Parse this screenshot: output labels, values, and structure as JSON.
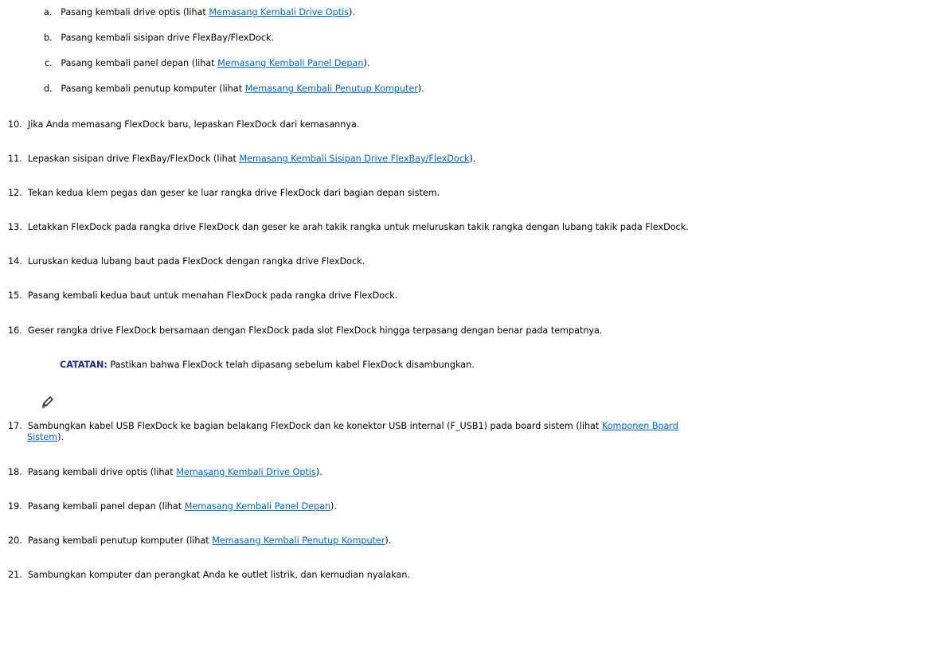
{
  "substeps": [
    {
      "marker": "a.",
      "pre": "Pasang kembali drive optis (lihat ",
      "link": "Memasang Kembali Drive Optis",
      "post": ")."
    },
    {
      "marker": "b.",
      "pre": "Pasang kembali sisipan drive FlexBay/FlexDock.",
      "link": "",
      "post": ""
    },
    {
      "marker": "c.",
      "pre": "Pasang kembali panel depan (lihat ",
      "link": "Memasang Kembali Panel Depan",
      "post": ")."
    },
    {
      "marker": "d.",
      "pre": "Pasang kembali penutup komputer (lihat ",
      "link": "Memasang Kembali Penutup Komputer",
      "post": ")."
    }
  ],
  "steps": [
    {
      "num": "10.",
      "pre": "Jika Anda memasang FlexDock baru, lepaskan FlexDock dari kemasannya.",
      "link": "",
      "post": ""
    },
    {
      "num": "11.",
      "pre": "Lepaskan sisipan drive FlexBay/FlexDock (lihat ",
      "link": "Memasang Kembali Sisipan Drive FlexBay/FlexDock",
      "post": ")."
    },
    {
      "num": "12.",
      "pre": "Tekan kedua klem pegas dan geser ke luar rangka drive FlexDock dari bagian depan sistem.",
      "link": "",
      "post": ""
    },
    {
      "num": "13.",
      "pre": "Letakkan FlexDock pada rangka drive FlexDock dan geser ke arah takik rangka untuk meluruskan takik rangka dengan lubang takik pada FlexDock.",
      "link": "",
      "post": ""
    },
    {
      "num": "14.",
      "pre": "Luruskan kedua lubang baut pada FlexDock dengan rangka drive FlexDock.",
      "link": "",
      "post": ""
    },
    {
      "num": "15.",
      "pre": "Pasang kembali kedua baut untuk menahan FlexDock pada rangka drive FlexDock.",
      "link": "",
      "post": ""
    },
    {
      "num": "16.",
      "pre": "Geser rangka drive FlexDock bersamaan dengan FlexDock pada slot FlexDock hingga terpasang dengan benar pada tempatnya.",
      "link": "",
      "post": ""
    }
  ],
  "note": {
    "label": "CATATAN:",
    "text": " Pastikan bahwa FlexDock telah dipasang sebelum kabel FlexDock disambungkan."
  },
  "step17": {
    "num": "17.",
    "pre": "Sambungkan kabel USB FlexDock ke bagian belakang FlexDock dan ke konektor USB internal (F_USB1) pada board sistem (lihat ",
    "link1": "Komponen Board",
    "link2": "Sistem",
    "post": ")."
  },
  "steps_after": [
    {
      "num": "18.",
      "pre": "Pasang kembali drive optis (lihat ",
      "link": "Memasang Kembali Drive Optis",
      "post": ")."
    },
    {
      "num": "19.",
      "pre": "Pasang kembali panel depan (lihat ",
      "link": "Memasang Kembali Panel Depan",
      "post": ")."
    },
    {
      "num": "20.",
      "pre": "Pasang kembali penutup komputer (lihat ",
      "link": "Memasang Kembali Penutup Komputer",
      "post": ")."
    },
    {
      "num": "21.",
      "pre": "Sambungkan komputer dan perangkat Anda ke outlet listrik, dan kemudian nyalakan.",
      "link": "",
      "post": ""
    }
  ]
}
